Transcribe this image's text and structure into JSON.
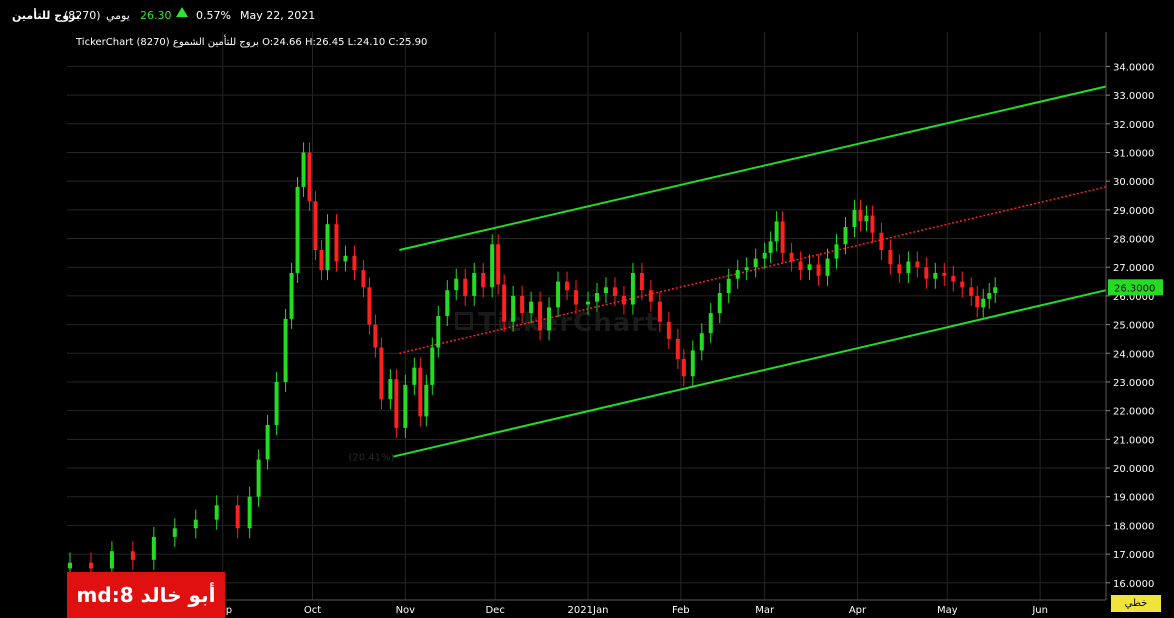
{
  "header": {
    "name": "بروج للتأمين",
    "code": "(8270)",
    "period": "يومي",
    "price": "26.30",
    "change": "0.57%",
    "date": "May 22, 2021"
  },
  "legend_line": "TickerChart بروج للتأمين الشموع (8270) O:24.66  H:26.45  L:24.10  C:25.90",
  "watermark": "TickerChart",
  "badge": "md:8 أبو خالد",
  "line_type_button": "خطي",
  "colors": {
    "up": "#22dd22",
    "down": "#ff2020",
    "channel": "#22dd22",
    "midline": "#ff2020",
    "grid": "#262626"
  },
  "chart_data": {
    "type": "candlestick",
    "y_axis_position": "right",
    "ylim": [
      15.4,
      35.2
    ],
    "yticks": [
      "16.0000",
      "17.0000",
      "18.0000",
      "19.0000",
      "20.0000",
      "21.0000",
      "22.0000",
      "23.0000",
      "24.0000",
      "25.0000",
      "26.0000",
      "27.0000",
      "28.0000",
      "29.0000",
      "30.0000",
      "31.0000",
      "32.0000",
      "33.0000",
      "34.0000"
    ],
    "x_range": [
      "2020-07-11",
      "2021-06-23"
    ],
    "month_ticks": [
      {
        "date": "2020-09-01",
        "label": "Sep"
      },
      {
        "date": "2020-10-01",
        "label": "Oct"
      },
      {
        "date": "2020-11-01",
        "label": "Nov"
      },
      {
        "date": "2020-12-01",
        "label": "Dec"
      },
      {
        "date": "2021-01-01",
        "label": "2021Jan"
      },
      {
        "date": "2021-02-01",
        "label": "Feb"
      },
      {
        "date": "2021-03-01",
        "label": "Mar"
      },
      {
        "date": "2021-04-01",
        "label": "Apr"
      },
      {
        "date": "2021-05-01",
        "label": "May"
      },
      {
        "date": "2021-06-01",
        "label": "Jun"
      }
    ],
    "last_price_label": "26.3000",
    "closes": [
      {
        "d": "2020-07-12",
        "c": 16.7
      },
      {
        "d": "2020-07-19",
        "c": 16.5
      },
      {
        "d": "2020-07-26",
        "c": 17.1
      },
      {
        "d": "2020-08-02",
        "c": 16.8
      },
      {
        "d": "2020-08-09",
        "c": 17.6
      },
      {
        "d": "2020-08-16",
        "c": 17.9
      },
      {
        "d": "2020-08-23",
        "c": 18.2
      },
      {
        "d": "2020-08-30",
        "c": 18.7
      },
      {
        "d": "2020-09-06",
        "c": 17.9
      },
      {
        "d": "2020-09-10",
        "c": 19.0
      },
      {
        "d": "2020-09-13",
        "c": 20.3
      },
      {
        "d": "2020-09-16",
        "c": 21.5
      },
      {
        "d": "2020-09-19",
        "c": 23.0
      },
      {
        "d": "2020-09-22",
        "c": 25.2
      },
      {
        "d": "2020-09-24",
        "c": 26.8
      },
      {
        "d": "2020-09-26",
        "c": 29.8
      },
      {
        "d": "2020-09-28",
        "c": 31.0
      },
      {
        "d": "2020-09-30",
        "c": 29.3
      },
      {
        "d": "2020-10-02",
        "c": 27.6
      },
      {
        "d": "2020-10-04",
        "c": 26.9
      },
      {
        "d": "2020-10-06",
        "c": 28.5
      },
      {
        "d": "2020-10-09",
        "c": 27.2
      },
      {
        "d": "2020-10-12",
        "c": 27.4
      },
      {
        "d": "2020-10-15",
        "c": 26.9
      },
      {
        "d": "2020-10-18",
        "c": 26.3
      },
      {
        "d": "2020-10-20",
        "c": 25.0
      },
      {
        "d": "2020-10-22",
        "c": 24.2
      },
      {
        "d": "2020-10-24",
        "c": 22.4
      },
      {
        "d": "2020-10-27",
        "c": 23.1
      },
      {
        "d": "2020-10-29",
        "c": 21.4
      },
      {
        "d": "2020-11-01",
        "c": 22.9
      },
      {
        "d": "2020-11-04",
        "c": 23.5
      },
      {
        "d": "2020-11-06",
        "c": 21.8
      },
      {
        "d": "2020-11-08",
        "c": 22.9
      },
      {
        "d": "2020-11-10",
        "c": 24.2
      },
      {
        "d": "2020-11-12",
        "c": 25.3
      },
      {
        "d": "2020-11-15",
        "c": 26.2
      },
      {
        "d": "2020-11-18",
        "c": 26.6
      },
      {
        "d": "2020-11-21",
        "c": 26.0
      },
      {
        "d": "2020-11-24",
        "c": 26.8
      },
      {
        "d": "2020-11-27",
        "c": 26.3
      },
      {
        "d": "2020-11-30",
        "c": 27.8
      },
      {
        "d": "2020-12-02",
        "c": 26.4
      },
      {
        "d": "2020-12-04",
        "c": 25.1
      },
      {
        "d": "2020-12-07",
        "c": 26.0
      },
      {
        "d": "2020-12-10",
        "c": 25.4
      },
      {
        "d": "2020-12-13",
        "c": 25.8
      },
      {
        "d": "2020-12-16",
        "c": 24.8
      },
      {
        "d": "2020-12-19",
        "c": 25.6
      },
      {
        "d": "2020-12-22",
        "c": 26.5
      },
      {
        "d": "2020-12-25",
        "c": 26.2
      },
      {
        "d": "2020-12-28",
        "c": 25.7
      },
      {
        "d": "2021-01-01",
        "c": 25.8
      },
      {
        "d": "2021-01-04",
        "c": 26.1
      },
      {
        "d": "2021-01-07",
        "c": 26.3
      },
      {
        "d": "2021-01-10",
        "c": 26.0
      },
      {
        "d": "2021-01-13",
        "c": 25.7
      },
      {
        "d": "2021-01-16",
        "c": 26.8
      },
      {
        "d": "2021-01-19",
        "c": 26.2
      },
      {
        "d": "2021-01-22",
        "c": 25.8
      },
      {
        "d": "2021-01-25",
        "c": 25.1
      },
      {
        "d": "2021-01-28",
        "c": 24.5
      },
      {
        "d": "2021-01-31",
        "c": 23.8
      },
      {
        "d": "2021-02-02",
        "c": 23.2
      },
      {
        "d": "2021-02-05",
        "c": 24.1
      },
      {
        "d": "2021-02-08",
        "c": 24.7
      },
      {
        "d": "2021-02-11",
        "c": 25.4
      },
      {
        "d": "2021-02-14",
        "c": 26.1
      },
      {
        "d": "2021-02-17",
        "c": 26.6
      },
      {
        "d": "2021-02-20",
        "c": 26.9
      },
      {
        "d": "2021-02-23",
        "c": 27.0
      },
      {
        "d": "2021-02-26",
        "c": 27.3
      },
      {
        "d": "2021-03-01",
        "c": 27.5
      },
      {
        "d": "2021-03-03",
        "c": 27.9
      },
      {
        "d": "2021-03-05",
        "c": 28.6
      },
      {
        "d": "2021-03-07",
        "c": 27.5
      },
      {
        "d": "2021-03-10",
        "c": 27.2
      },
      {
        "d": "2021-03-13",
        "c": 26.9
      },
      {
        "d": "2021-03-16",
        "c": 27.1
      },
      {
        "d": "2021-03-19",
        "c": 26.7
      },
      {
        "d": "2021-03-22",
        "c": 27.3
      },
      {
        "d": "2021-03-25",
        "c": 27.8
      },
      {
        "d": "2021-03-28",
        "c": 28.4
      },
      {
        "d": "2021-03-31",
        "c": 29.0
      },
      {
        "d": "2021-04-02",
        "c": 28.6
      },
      {
        "d": "2021-04-04",
        "c": 28.8
      },
      {
        "d": "2021-04-06",
        "c": 28.2
      },
      {
        "d": "2021-04-09",
        "c": 27.6
      },
      {
        "d": "2021-04-12",
        "c": 27.1
      },
      {
        "d": "2021-04-15",
        "c": 26.8
      },
      {
        "d": "2021-04-18",
        "c": 27.2
      },
      {
        "d": "2021-04-21",
        "c": 27.0
      },
      {
        "d": "2021-04-24",
        "c": 26.6
      },
      {
        "d": "2021-04-27",
        "c": 26.8
      },
      {
        "d": "2021-04-30",
        "c": 26.7
      },
      {
        "d": "2021-05-03",
        "c": 26.5
      },
      {
        "d": "2021-05-06",
        "c": 26.3
      },
      {
        "d": "2021-05-09",
        "c": 26.0
      },
      {
        "d": "2021-05-11",
        "c": 25.6
      },
      {
        "d": "2021-05-13",
        "c": 25.9
      },
      {
        "d": "2021-05-15",
        "c": 26.1
      },
      {
        "d": "2021-05-17",
        "c": 26.3
      }
    ],
    "channel": {
      "upper": [
        {
          "d": "2020-10-30",
          "v": 27.6
        },
        {
          "d": "2021-06-23",
          "v": 33.3
        }
      ],
      "middle": [
        {
          "d": "2020-10-30",
          "v": 24.0
        },
        {
          "d": "2021-06-23",
          "v": 29.8
        }
      ],
      "lower": [
        {
          "d": "2020-10-28",
          "v": 20.4
        },
        {
          "d": "2021-06-23",
          "v": 26.2
        }
      ]
    },
    "channel_labels": [
      {
        "text": "(20.41%)",
        "d": "2020-10-13",
        "v": 20.4
      }
    ]
  }
}
